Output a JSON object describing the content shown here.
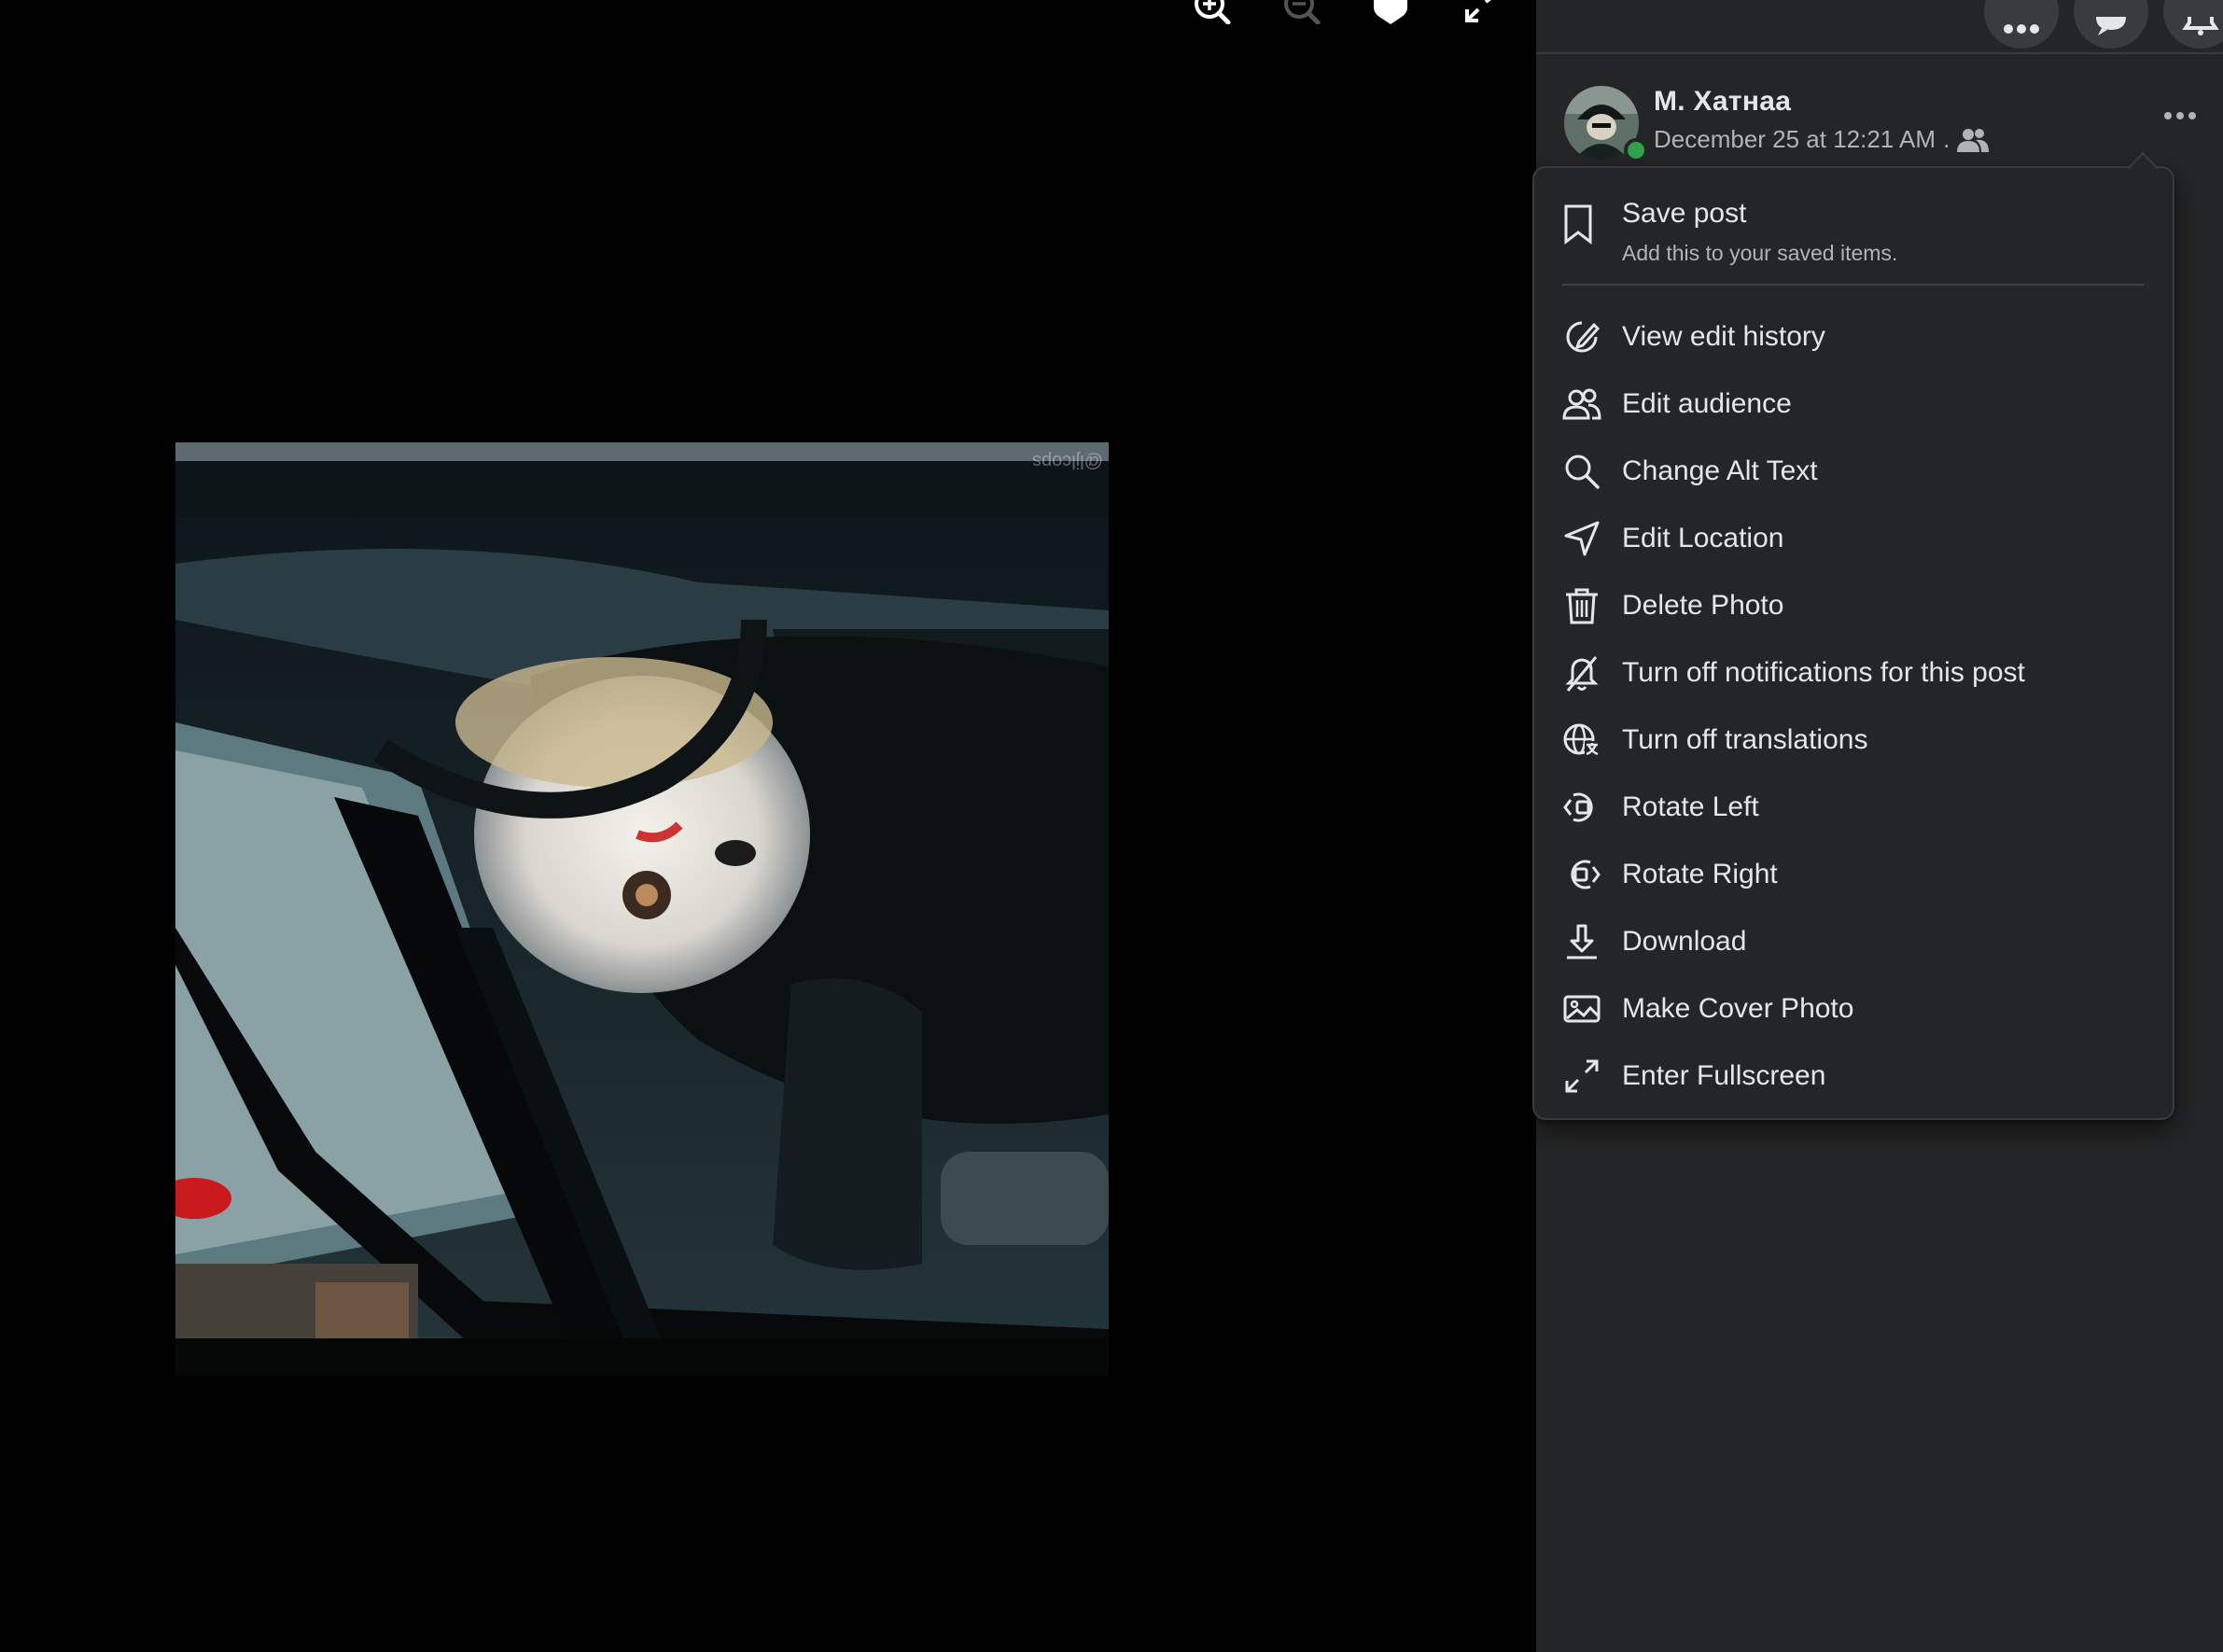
{
  "viewer": {
    "zoom_in_icon": "magnifier-plus",
    "zoom_out_icon": "magnifier-minus",
    "tag_icon": "tag",
    "fullscreen_icon": "expand",
    "photo_watermark": "@ljlcops"
  },
  "post": {
    "author": "М. Хатнаа",
    "timestamp": "December 25 at 12:21 AM",
    "separator": ".",
    "audience_icon": "friends-icon"
  },
  "menu": {
    "save": {
      "label": "Save post",
      "sublabel": "Add this to your saved items."
    },
    "items": [
      {
        "label": "View edit history",
        "icon": "edit-history-icon"
      },
      {
        "label": "Edit audience",
        "icon": "people-icon"
      },
      {
        "label": "Change Alt Text",
        "icon": "search-icon"
      },
      {
        "label": "Edit Location",
        "icon": "location-arrow-icon"
      },
      {
        "label": "Delete Photo",
        "icon": "trash-icon"
      },
      {
        "label": "Turn off notifications for this post",
        "icon": "bell-off-icon"
      },
      {
        "label": "Turn off translations",
        "icon": "globe-translate-icon"
      },
      {
        "label": "Rotate Left",
        "icon": "rotate-left-icon"
      },
      {
        "label": "Rotate Right",
        "icon": "rotate-right-icon"
      },
      {
        "label": "Download",
        "icon": "download-icon"
      },
      {
        "label": "Make Cover Photo",
        "icon": "image-icon"
      },
      {
        "label": "Enter Fullscreen",
        "icon": "fullscreen-icon"
      }
    ]
  },
  "colors": {
    "panel_bg": "#242526",
    "text_primary": "#e4e6eb",
    "text_secondary": "#b0b3b8",
    "online": "#31a24c"
  }
}
